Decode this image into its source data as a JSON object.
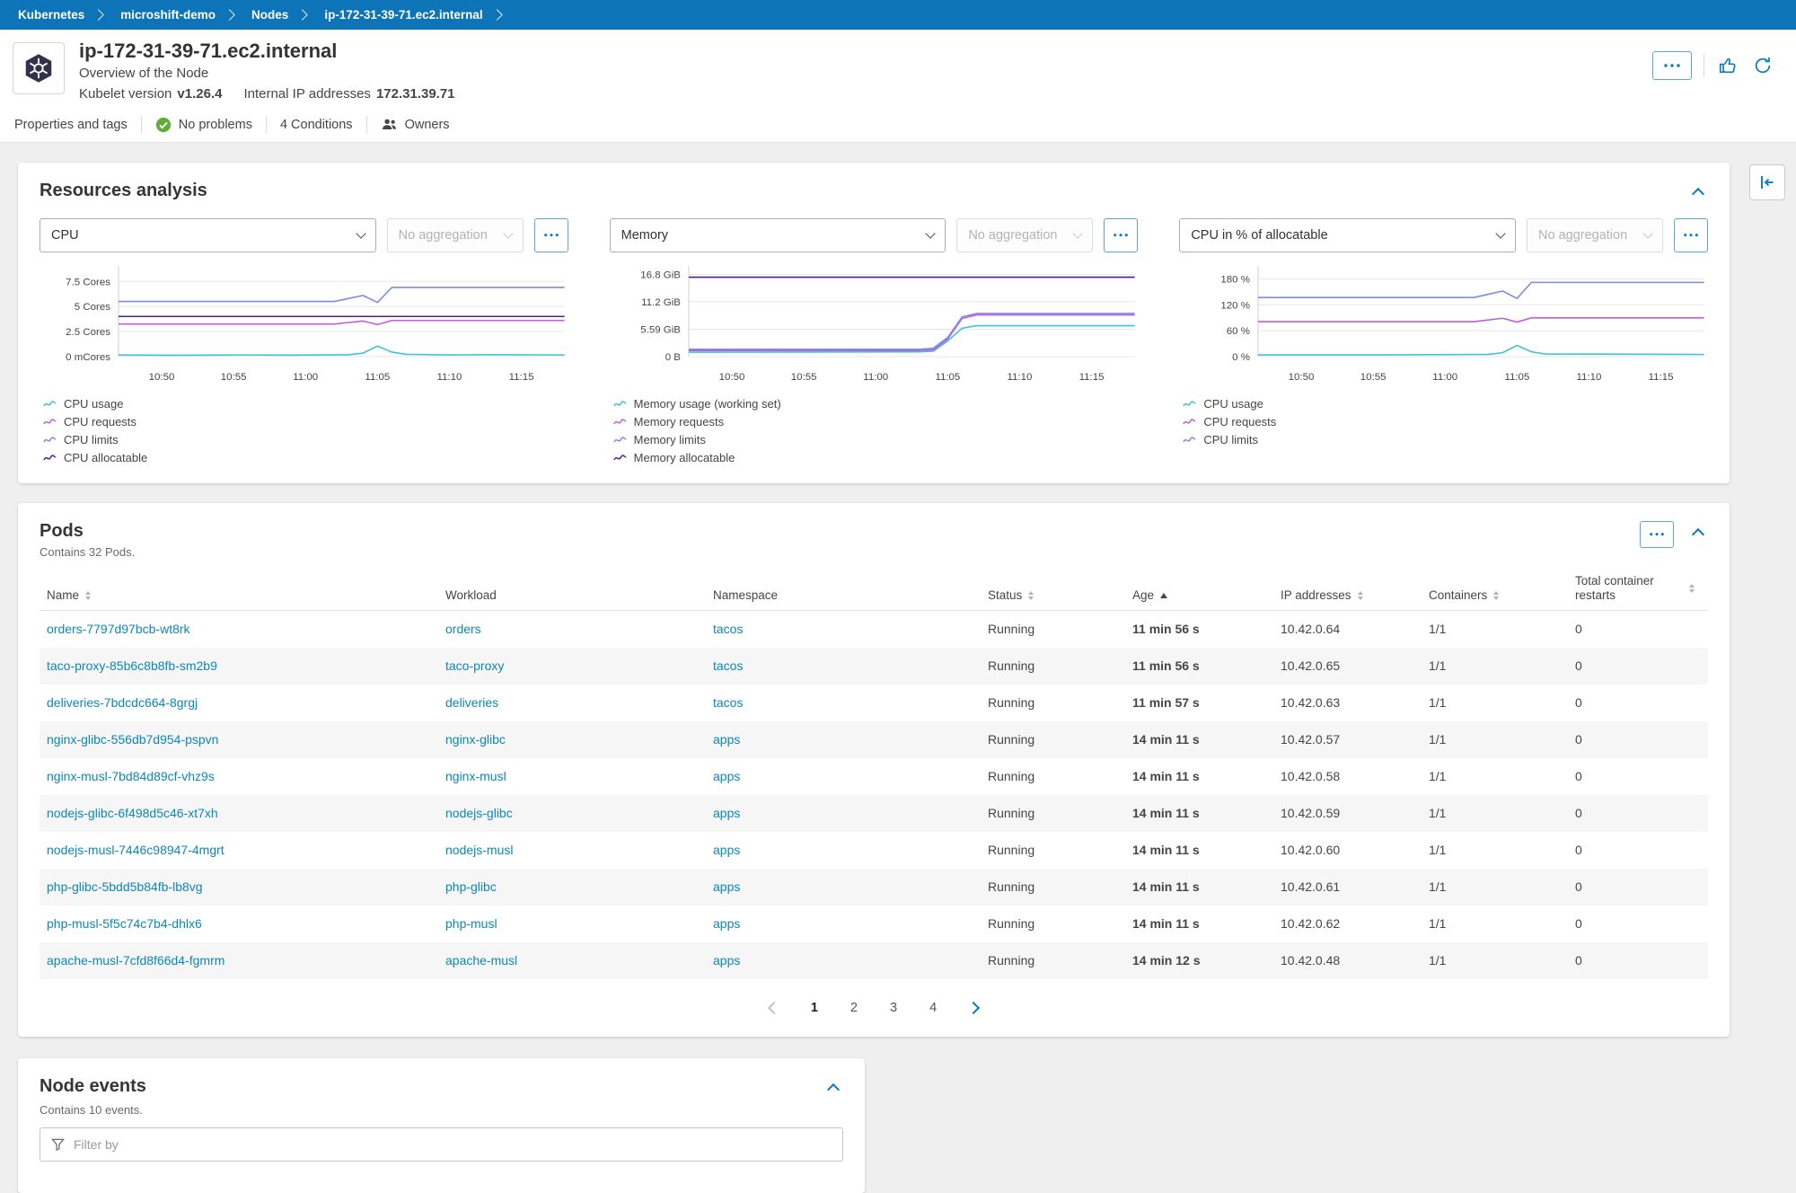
{
  "breadcrumb": {
    "items": [
      "Kubernetes",
      "microshift-demo",
      "Nodes",
      "ip-172-31-39-71.ec2.internal"
    ]
  },
  "header": {
    "title": "ip-172-31-39-71.ec2.internal",
    "subtitle": "Overview of the Node",
    "kubelet_label": "Kubelet version",
    "kubelet_value": "v1.26.4",
    "ip_label": "Internal IP addresses",
    "ip_value": "172.31.39.71"
  },
  "action_bar": {
    "items": [
      "Properties and tags",
      "No problems",
      "4 Conditions",
      "Owners"
    ]
  },
  "resources": {
    "title": "Resources analysis"
  },
  "chart_data": [
    {
      "type": "line",
      "metric": "CPU",
      "aggregation": "No aggregation",
      "xlim": [
        0,
        31
      ],
      "x_ticks": [
        {
          "pos": 3,
          "label": "10:50"
        },
        {
          "pos": 8,
          "label": "10:55"
        },
        {
          "pos": 13,
          "label": "11:00"
        },
        {
          "pos": 18,
          "label": "11:05"
        },
        {
          "pos": 23,
          "label": "11:10"
        },
        {
          "pos": 28,
          "label": "11:15"
        }
      ],
      "ylim": [
        0,
        8.6
      ],
      "y_ticks": [
        {
          "value": 7.5,
          "label": "7.5 Cores"
        },
        {
          "value": 5,
          "label": "5 Cores"
        },
        {
          "value": 2.5,
          "label": "2.5 Cores"
        },
        {
          "value": 0,
          "label": "0 mCores"
        }
      ],
      "series": [
        {
          "name": "CPU usage",
          "color": "#3fc3d2",
          "points": [
            [
              0,
              0.15
            ],
            [
              4,
              0.13
            ],
            [
              8,
              0.16
            ],
            [
              12,
              0.14
            ],
            [
              16,
              0.18
            ],
            [
              17,
              0.35
            ],
            [
              18,
              1.05
            ],
            [
              19,
              0.45
            ],
            [
              20,
              0.22
            ],
            [
              23,
              0.17
            ],
            [
              26,
              0.19
            ],
            [
              31,
              0.16
            ]
          ]
        },
        {
          "name": "CPU requests",
          "color": "#c25ddb",
          "points": [
            [
              0,
              3.25
            ],
            [
              15,
              3.25
            ],
            [
              17,
              3.55
            ],
            [
              18,
              3.2
            ],
            [
              19,
              3.6
            ],
            [
              31,
              3.6
            ]
          ]
        },
        {
          "name": "CPU limits",
          "color": "#7d8ae8",
          "points": [
            [
              0,
              5.5
            ],
            [
              15,
              5.5
            ],
            [
              17,
              6.1
            ],
            [
              18,
              5.4
            ],
            [
              19,
              6.9
            ],
            [
              31,
              6.9
            ]
          ]
        },
        {
          "name": "CPU allocatable",
          "color": "#531e96",
          "points": [
            [
              0,
              4.0
            ],
            [
              31,
              4.0
            ]
          ]
        }
      ]
    },
    {
      "type": "line",
      "metric": "Memory",
      "aggregation": "No aggregation",
      "xlim": [
        0,
        31
      ],
      "x_ticks": [
        {
          "pos": 3,
          "label": "10:50"
        },
        {
          "pos": 8,
          "label": "10:55"
        },
        {
          "pos": 13,
          "label": "11:00"
        },
        {
          "pos": 18,
          "label": "11:05"
        },
        {
          "pos": 23,
          "label": "11:10"
        },
        {
          "pos": 28,
          "label": "11:15"
        }
      ],
      "ylim": [
        0,
        17.6
      ],
      "y_ticks": [
        {
          "value": 16.8,
          "label": "16.8 GiB"
        },
        {
          "value": 11.2,
          "label": "11.2 GiB"
        },
        {
          "value": 5.59,
          "label": "5.59 GiB"
        },
        {
          "value": 0,
          "label": "0 B"
        }
      ],
      "series": [
        {
          "name": "Memory usage (working set)",
          "color": "#3fc3d2",
          "points": [
            [
              0,
              0.9
            ],
            [
              16,
              0.95
            ],
            [
              17,
              1.1
            ],
            [
              18,
              3.2
            ],
            [
              19,
              5.8
            ],
            [
              20,
              6.3
            ],
            [
              31,
              6.3
            ]
          ]
        },
        {
          "name": "Memory requests",
          "color": "#c25ddb",
          "points": [
            [
              0,
              1.25
            ],
            [
              16,
              1.25
            ],
            [
              17,
              1.4
            ],
            [
              18,
              3.6
            ],
            [
              19,
              7.8
            ],
            [
              20,
              8.5
            ],
            [
              31,
              8.5
            ]
          ]
        },
        {
          "name": "Memory limits",
          "color": "#7d8ae8",
          "points": [
            [
              0,
              1.5
            ],
            [
              16,
              1.5
            ],
            [
              17,
              1.7
            ],
            [
              18,
              3.9
            ],
            [
              19,
              8.1
            ],
            [
              20,
              8.8
            ],
            [
              31,
              8.8
            ]
          ]
        },
        {
          "name": "Memory allocatable",
          "color": "#531e96",
          "points": [
            [
              0,
              16.2
            ],
            [
              31,
              16.2
            ]
          ]
        }
      ]
    },
    {
      "type": "line",
      "metric": "CPU in % of allocatable",
      "aggregation": "No aggregation",
      "xlim": [
        0,
        31
      ],
      "x_ticks": [
        {
          "pos": 3,
          "label": "10:50"
        },
        {
          "pos": 8,
          "label": "10:55"
        },
        {
          "pos": 13,
          "label": "11:00"
        },
        {
          "pos": 18,
          "label": "11:05"
        },
        {
          "pos": 23,
          "label": "11:10"
        },
        {
          "pos": 28,
          "label": "11:15"
        }
      ],
      "ylim": [
        0,
        200
      ],
      "y_ticks": [
        {
          "value": 180,
          "label": "180 %"
        },
        {
          "value": 120,
          "label": "120 %"
        },
        {
          "value": 60,
          "label": "60 %"
        },
        {
          "value": 0,
          "label": "0 %"
        }
      ],
      "series": [
        {
          "name": "CPU usage",
          "color": "#3fc3d2",
          "points": [
            [
              0,
              4
            ],
            [
              8,
              4
            ],
            [
              16,
              5
            ],
            [
              17,
              9
            ],
            [
              18,
              26
            ],
            [
              19,
              11
            ],
            [
              20,
              6
            ],
            [
              31,
              5
            ]
          ]
        },
        {
          "name": "CPU requests",
          "color": "#c25ddb",
          "points": [
            [
              0,
              81
            ],
            [
              15,
              81
            ],
            [
              17,
              89
            ],
            [
              18,
              80
            ],
            [
              19,
              90
            ],
            [
              31,
              90
            ]
          ]
        },
        {
          "name": "CPU limits",
          "color": "#7d8ae8",
          "points": [
            [
              0,
              137
            ],
            [
              15,
              137
            ],
            [
              17,
              152
            ],
            [
              18,
              135
            ],
            [
              19,
              172
            ],
            [
              31,
              172
            ]
          ]
        }
      ]
    }
  ],
  "pods": {
    "title": "Pods",
    "subtitle": "Contains 32 Pods.",
    "columns": [
      "Name",
      "Workload",
      "Namespace",
      "Status",
      "Age",
      "IP addresses",
      "Containers",
      "Total container restarts"
    ],
    "rows": [
      {
        "name": "orders-7797d97bcb-wt8rk",
        "workload": "orders",
        "namespace": "tacos",
        "status": "Running",
        "age": "11 min 56 s",
        "ip": "10.42.0.64",
        "containers": "1/1",
        "restarts": "0"
      },
      {
        "name": "taco-proxy-85b6c8b8fb-sm2b9",
        "workload": "taco-proxy",
        "namespace": "tacos",
        "status": "Running",
        "age": "11 min 56 s",
        "ip": "10.42.0.65",
        "containers": "1/1",
        "restarts": "0"
      },
      {
        "name": "deliveries-7bdcdc664-8grgj",
        "workload": "deliveries",
        "namespace": "tacos",
        "status": "Running",
        "age": "11 min 57 s",
        "ip": "10.42.0.63",
        "containers": "1/1",
        "restarts": "0"
      },
      {
        "name": "nginx-glibc-556db7d954-pspvn",
        "workload": "nginx-glibc",
        "namespace": "apps",
        "status": "Running",
        "age": "14 min 11 s",
        "ip": "10.42.0.57",
        "containers": "1/1",
        "restarts": "0"
      },
      {
        "name": "nginx-musl-7bd84d89cf-vhz9s",
        "workload": "nginx-musl",
        "namespace": "apps",
        "status": "Running",
        "age": "14 min 11 s",
        "ip": "10.42.0.58",
        "containers": "1/1",
        "restarts": "0"
      },
      {
        "name": "nodejs-glibc-6f498d5c46-xt7xh",
        "workload": "nodejs-glibc",
        "namespace": "apps",
        "status": "Running",
        "age": "14 min 11 s",
        "ip": "10.42.0.59",
        "containers": "1/1",
        "restarts": "0"
      },
      {
        "name": "nodejs-musl-7446c98947-4mgrt",
        "workload": "nodejs-musl",
        "namespace": "apps",
        "status": "Running",
        "age": "14 min 11 s",
        "ip": "10.42.0.60",
        "containers": "1/1",
        "restarts": "0"
      },
      {
        "name": "php-glibc-5bdd5b84fb-lb8vg",
        "workload": "php-glibc",
        "namespace": "apps",
        "status": "Running",
        "age": "14 min 11 s",
        "ip": "10.42.0.61",
        "containers": "1/1",
        "restarts": "0"
      },
      {
        "name": "php-musl-5f5c74c7b4-dhlx6",
        "workload": "php-musl",
        "namespace": "apps",
        "status": "Running",
        "age": "14 min 11 s",
        "ip": "10.42.0.62",
        "containers": "1/1",
        "restarts": "0"
      },
      {
        "name": "apache-musl-7cfd8f66d4-fgmrm",
        "workload": "apache-musl",
        "namespace": "apps",
        "status": "Running",
        "age": "14 min 12 s",
        "ip": "10.42.0.48",
        "containers": "1/1",
        "restarts": "0"
      }
    ],
    "pagination": {
      "pages": [
        "1",
        "2",
        "3",
        "4"
      ],
      "current": "1"
    }
  },
  "node_events": {
    "title": "Node events",
    "subtitle": "Contains 10 events.",
    "filter_placeholder": "Filter by"
  },
  "colors": {
    "breadcrumb_bg": "#0c74b7",
    "link": "#0b87b8",
    "accent": "#0a7cc1",
    "status_green": "#5ead35",
    "series_usage": "#3fc3d2",
    "series_requests": "#c25ddb",
    "series_limits": "#7d8ae8",
    "series_allocatable": "#531e96"
  }
}
